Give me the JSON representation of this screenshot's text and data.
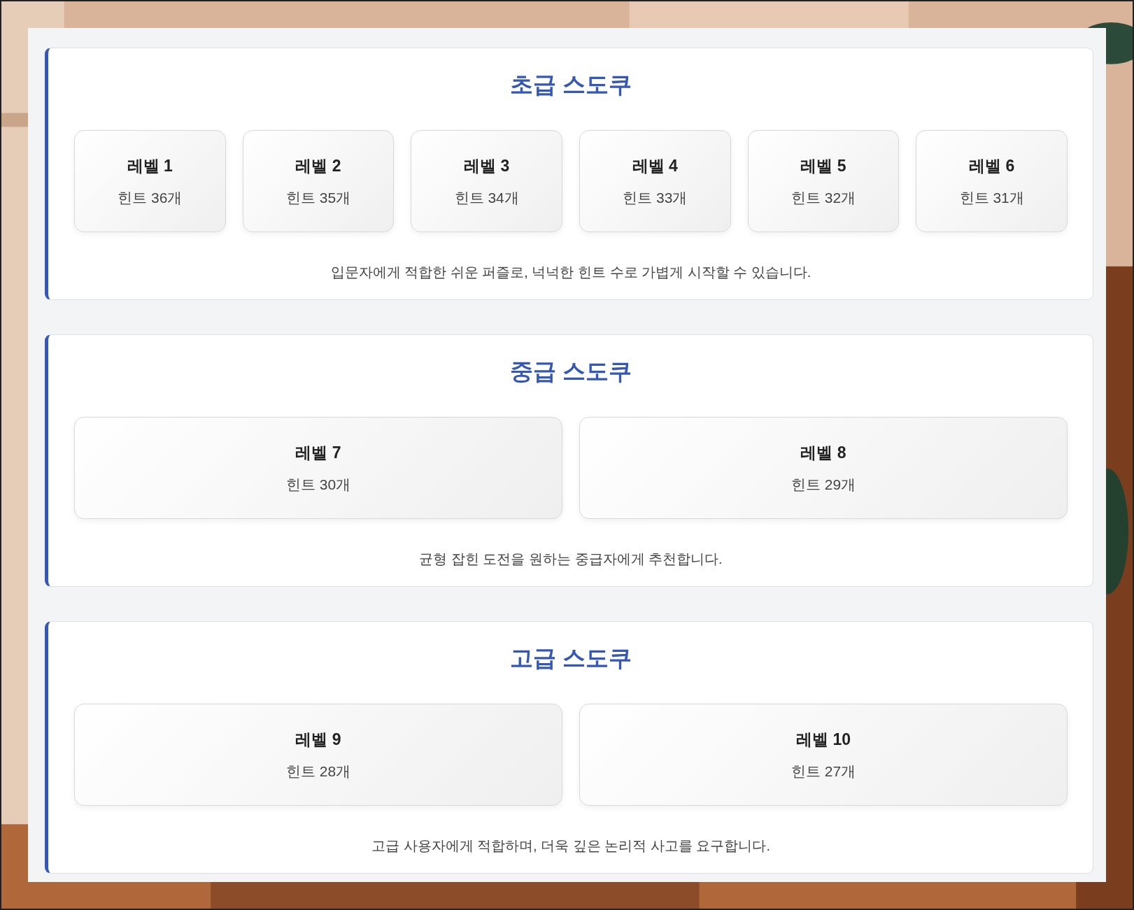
{
  "sections": [
    {
      "title": "초급 스도쿠",
      "levels": [
        {
          "label": "레벨 1",
          "hints": "힌트 36개"
        },
        {
          "label": "레벨 2",
          "hints": "힌트 35개"
        },
        {
          "label": "레벨 3",
          "hints": "힌트 34개"
        },
        {
          "label": "레벨 4",
          "hints": "힌트 33개"
        },
        {
          "label": "레벨 5",
          "hints": "힌트 32개"
        },
        {
          "label": "레벨 6",
          "hints": "힌트 31개"
        }
      ],
      "description": "입문자에게 적합한 쉬운 퍼즐로, 넉넉한 힌트 수로 가볍게 시작할 수 있습니다."
    },
    {
      "title": "중급 스도쿠",
      "levels": [
        {
          "label": "레벨 7",
          "hints": "힌트 30개"
        },
        {
          "label": "레벨 8",
          "hints": "힌트 29개"
        }
      ],
      "description": "균형 잡힌 도전을 원하는 중급자에게 추천합니다."
    },
    {
      "title": "고급 스도쿠",
      "levels": [
        {
          "label": "레벨 9",
          "hints": "힌트 28개"
        },
        {
          "label": "레벨 10",
          "hints": "힌트 27개"
        }
      ],
      "description": "고급 사용자에게 적합하며, 더욱 깊은 논리적 사고를 요구합니다."
    }
  ]
}
